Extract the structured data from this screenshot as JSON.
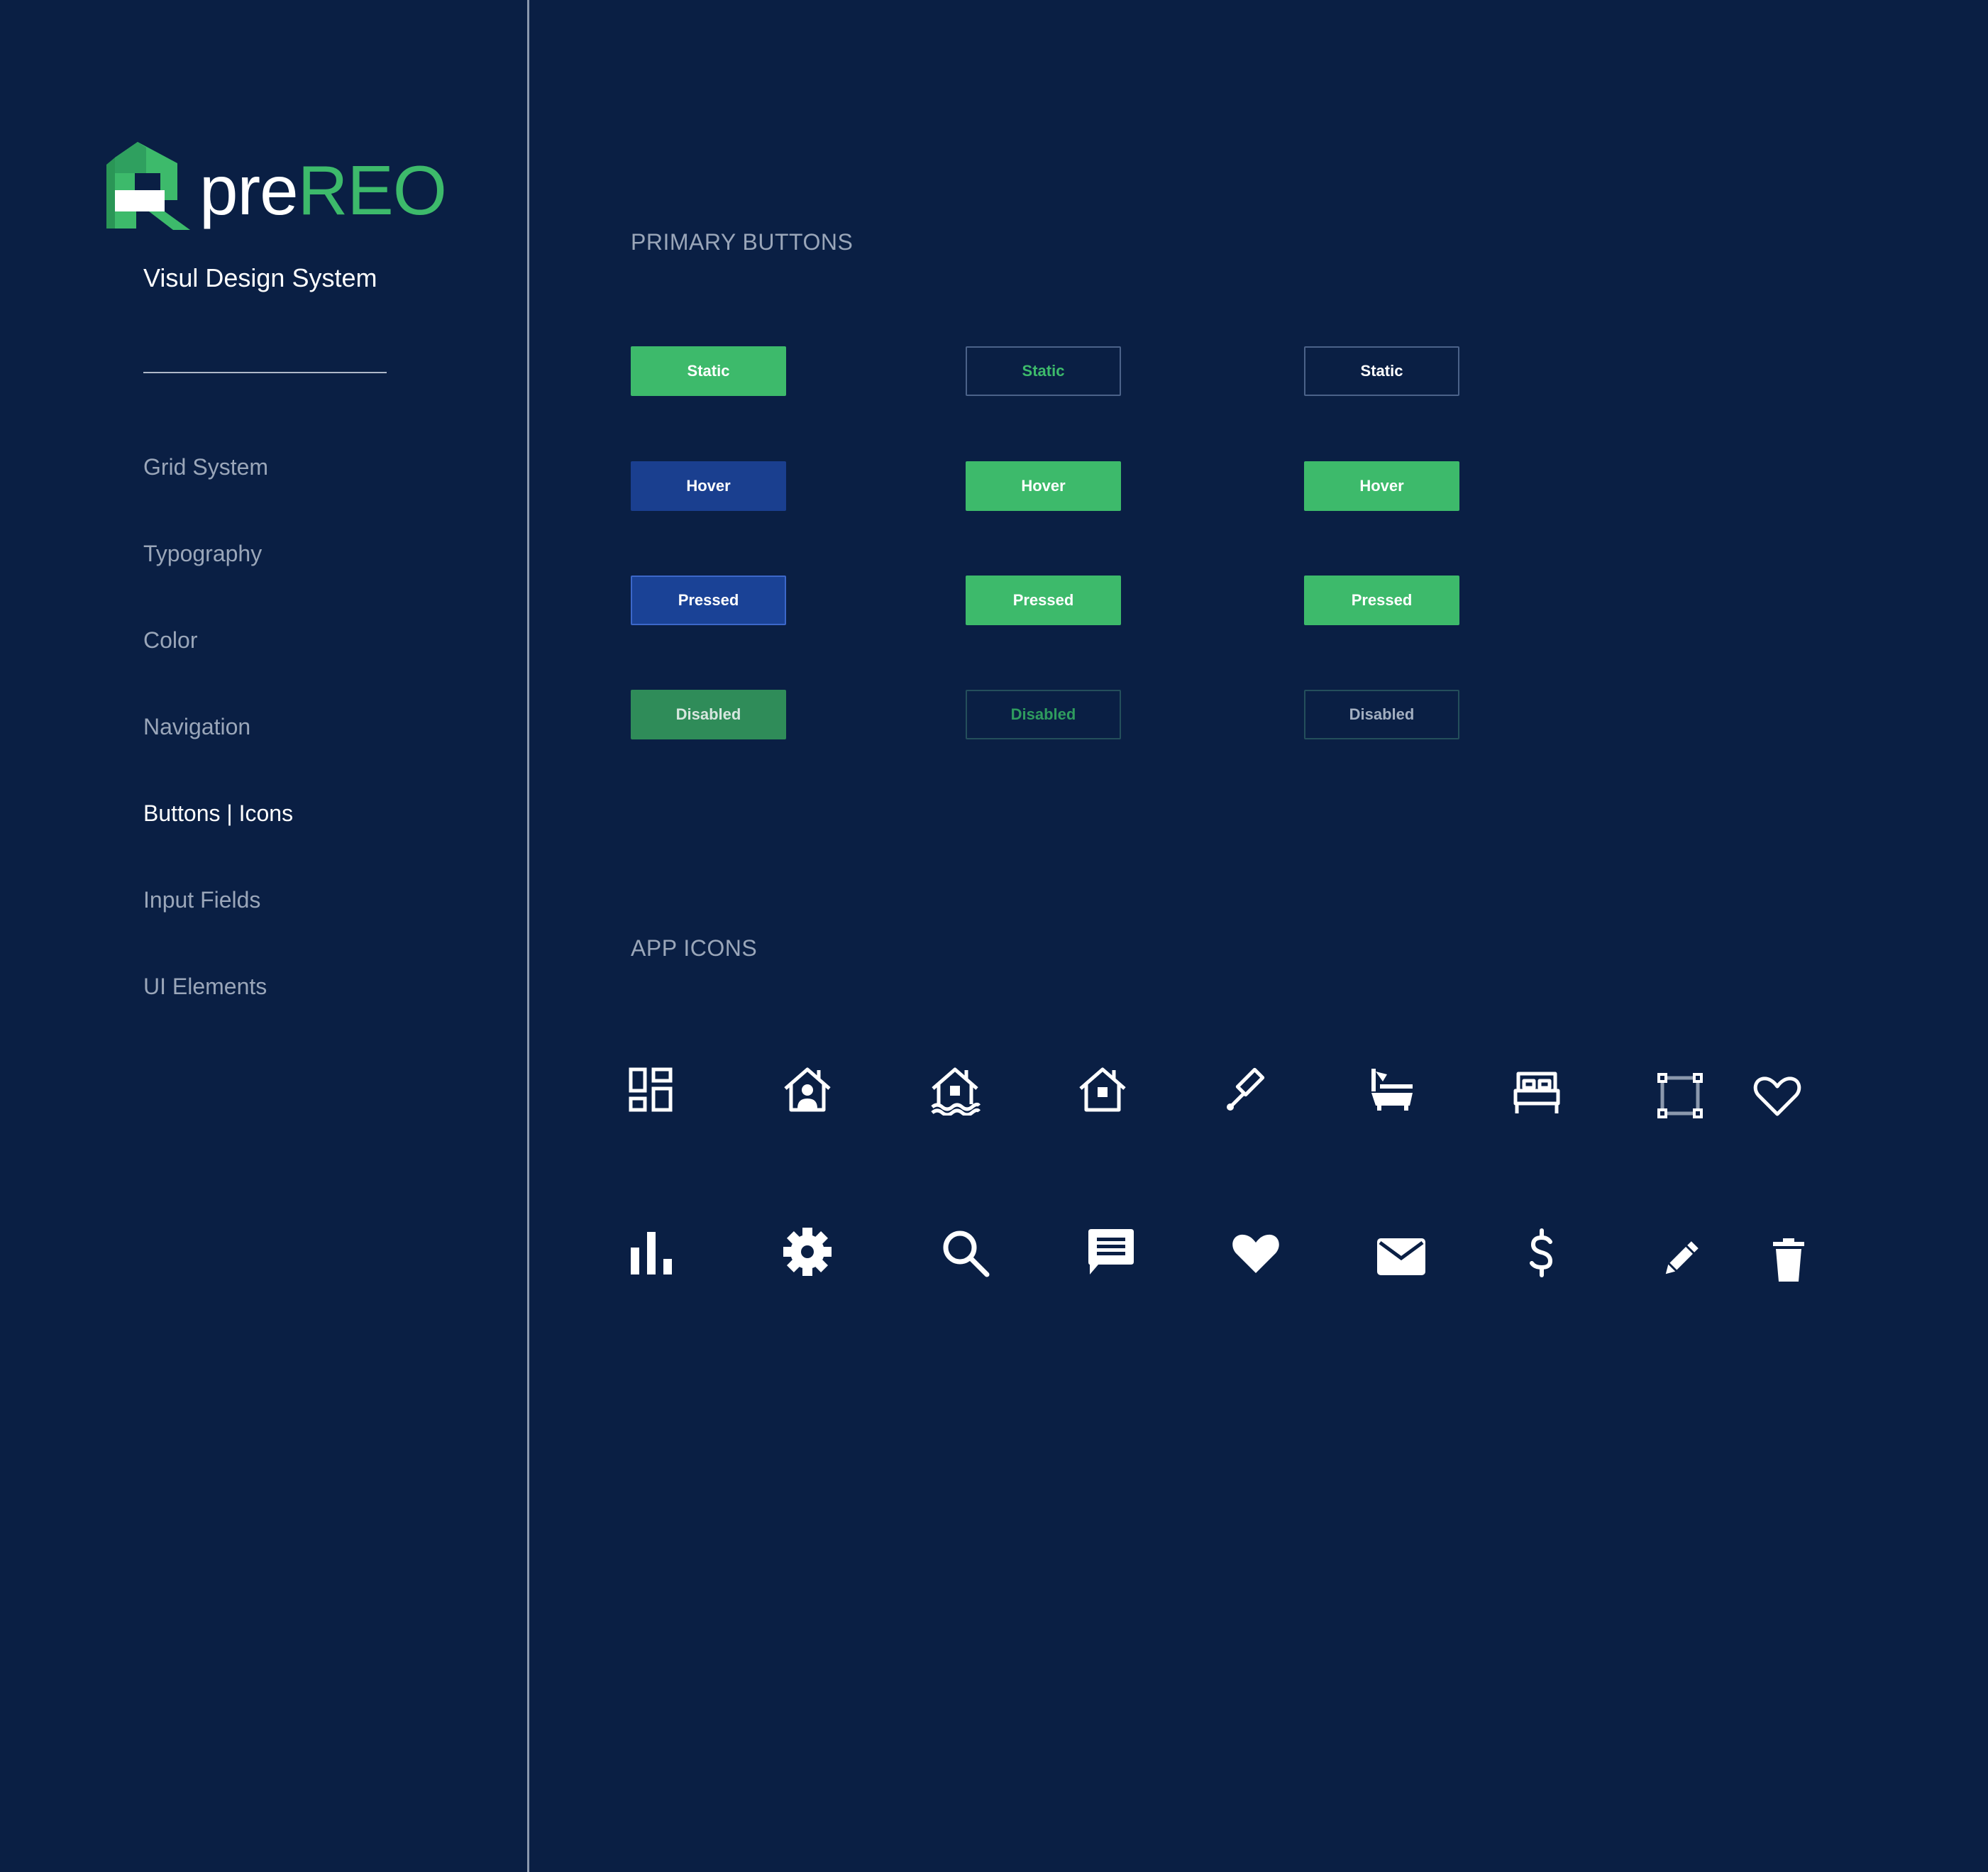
{
  "brand": {
    "logo_pre": "pre",
    "logo_reo": "REO",
    "subtitle": "Visul Design System",
    "accent_color": "#3dba6b",
    "background_color": "#0a1f44"
  },
  "nav": {
    "items": [
      {
        "label": "Grid System"
      },
      {
        "label": "Typography"
      },
      {
        "label": "Color"
      },
      {
        "label": "Navigation"
      },
      {
        "label": "Buttons | Icons"
      },
      {
        "label": "Input Fields"
      },
      {
        "label": "UI Elements"
      }
    ],
    "active": "Buttons | Icons"
  },
  "buttons_section": {
    "title": "PRIMARY BUTTONS",
    "columns": [
      {
        "static": "Static",
        "hover": "Hover",
        "pressed": "Pressed",
        "disabled": "Disabled"
      },
      {
        "static": "Static",
        "hover": "Hover",
        "pressed": "Pressed",
        "disabled": "Disabled"
      },
      {
        "static": "Static",
        "hover": "Hover",
        "pressed": "Pressed",
        "disabled": "Disabled"
      }
    ]
  },
  "icons_section": {
    "title": "APP ICONS",
    "row1": [
      "dashboard-icon",
      "home-user-icon",
      "home-flood-icon",
      "home-icon",
      "gavel-icon",
      "bathtub-icon",
      "bed-icon",
      "area-select-icon",
      "heart-outline-icon"
    ],
    "row2": [
      "bar-chart-icon",
      "gear-icon",
      "search-icon",
      "chat-icon",
      "heart-filled-icon",
      "envelope-icon",
      "dollar-icon",
      "pencil-icon",
      "trash-icon"
    ]
  }
}
